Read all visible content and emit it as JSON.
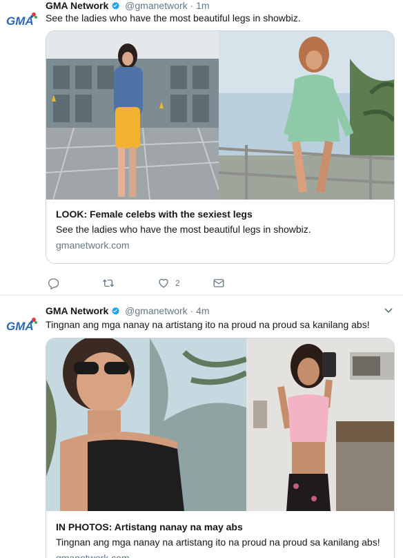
{
  "tweets": [
    {
      "account_name": "GMA Network",
      "handle": "@gmanetwork",
      "separator": "·",
      "time": "1m",
      "text": "See the ladies who have the most beautiful legs in showbiz.",
      "card": {
        "title": "LOOK: Female celebs with the sexiest legs",
        "description": "See the ladies who have the most beautiful legs in showbiz.",
        "domain": "gmanetwork.com"
      },
      "actions": {
        "reply_count": "",
        "retweet_count": "",
        "like_count": "2",
        "icons": [
          "reply-icon",
          "retweet-icon",
          "like-icon",
          "direct-message-icon"
        ]
      }
    },
    {
      "account_name": "GMA Network",
      "handle": "@gmanetwork",
      "separator": "·",
      "time": "4m",
      "text": "Tingnan ang mga nanay na artistang ito na proud na proud sa kanilang abs!",
      "card": {
        "title": "IN PHOTOS: Artistang nanay na may abs",
        "description": "Tingnan ang mga nanay na artistang ito na proud na proud sa kanilang abs!",
        "domain": "gmanetwork.com"
      }
    }
  ],
  "colors": {
    "name_text": "#14171a",
    "secondary_text": "#657786",
    "verified_badge": "#1da1f2",
    "card_border": "#ccd6dd",
    "divider": "#e6ecf0",
    "gma_blue": "#2b67b3"
  }
}
